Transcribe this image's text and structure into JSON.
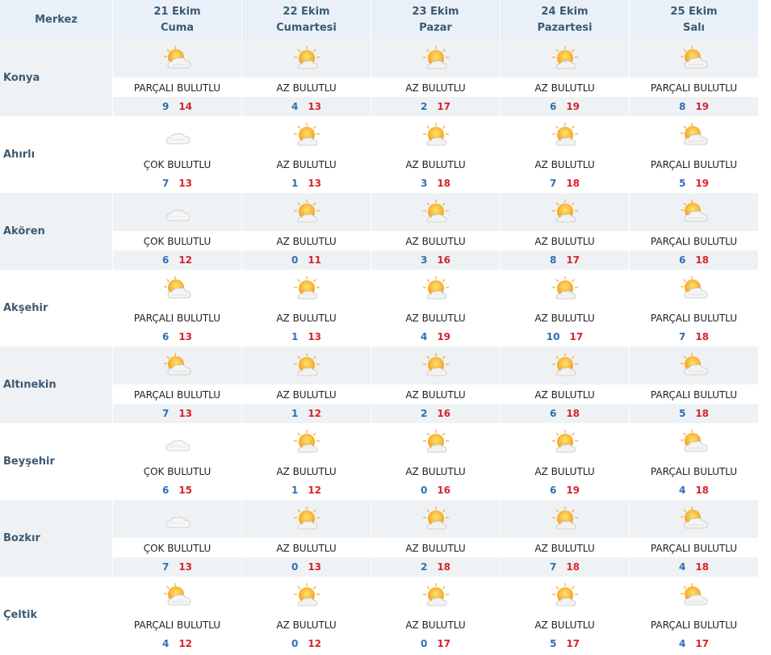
{
  "header": {
    "corner": "Merkez",
    "days": [
      {
        "date": "21 Ekim",
        "weekday": "Cuma"
      },
      {
        "date": "22 Ekim",
        "weekday": "Cumartesi"
      },
      {
        "date": "23 Ekim",
        "weekday": "Pazar"
      },
      {
        "date": "24 Ekim",
        "weekday": "Pazartesi"
      },
      {
        "date": "25 Ekim",
        "weekday": "Salı"
      }
    ]
  },
  "colors": {
    "header_bg": "#e9f0f7",
    "band_bg": "#eef2f5",
    "city_text": "#3d5a73",
    "min_temp": "#2f6fb3",
    "max_temp": "#d9232d"
  },
  "rows": [
    {
      "city": "Konya",
      "shaded": true,
      "days": [
        {
          "icon": "partly-cloudy-icon",
          "condition": "PARÇALI BULUTLU",
          "min": "9",
          "max": "14"
        },
        {
          "icon": "mostly-sunny-icon",
          "condition": "AZ BULUTLU",
          "min": "4",
          "max": "13"
        },
        {
          "icon": "mostly-sunny-icon",
          "condition": "AZ BULUTLU",
          "min": "2",
          "max": "17"
        },
        {
          "icon": "mostly-sunny-icon",
          "condition": "AZ BULUTLU",
          "min": "6",
          "max": "19"
        },
        {
          "icon": "partly-cloudy-icon",
          "condition": "PARÇALI BULUTLU",
          "min": "8",
          "max": "19"
        }
      ]
    },
    {
      "city": "Ahırlı",
      "shaded": false,
      "days": [
        {
          "icon": "cloudy-icon",
          "condition": "ÇOK BULUTLU",
          "min": "7",
          "max": "13"
        },
        {
          "icon": "mostly-sunny-icon",
          "condition": "AZ BULUTLU",
          "min": "1",
          "max": "13"
        },
        {
          "icon": "mostly-sunny-icon",
          "condition": "AZ BULUTLU",
          "min": "3",
          "max": "18"
        },
        {
          "icon": "mostly-sunny-icon",
          "condition": "AZ BULUTLU",
          "min": "7",
          "max": "18"
        },
        {
          "icon": "partly-cloudy-icon",
          "condition": "PARÇALI BULUTLU",
          "min": "5",
          "max": "19"
        }
      ]
    },
    {
      "city": "Akören",
      "shaded": true,
      "days": [
        {
          "icon": "cloudy-icon",
          "condition": "ÇOK BULUTLU",
          "min": "6",
          "max": "12"
        },
        {
          "icon": "mostly-sunny-icon",
          "condition": "AZ BULUTLU",
          "min": "0",
          "max": "11"
        },
        {
          "icon": "mostly-sunny-icon",
          "condition": "AZ BULUTLU",
          "min": "3",
          "max": "16"
        },
        {
          "icon": "mostly-sunny-icon",
          "condition": "AZ BULUTLU",
          "min": "8",
          "max": "17"
        },
        {
          "icon": "partly-cloudy-icon",
          "condition": "PARÇALI BULUTLU",
          "min": "6",
          "max": "18"
        }
      ]
    },
    {
      "city": "Akşehir",
      "shaded": false,
      "days": [
        {
          "icon": "partly-cloudy-icon",
          "condition": "PARÇALI BULUTLU",
          "min": "6",
          "max": "13"
        },
        {
          "icon": "mostly-sunny-icon",
          "condition": "AZ BULUTLU",
          "min": "1",
          "max": "13"
        },
        {
          "icon": "mostly-sunny-icon",
          "condition": "AZ BULUTLU",
          "min": "4",
          "max": "19"
        },
        {
          "icon": "mostly-sunny-icon",
          "condition": "AZ BULUTLU",
          "min": "10",
          "max": "17"
        },
        {
          "icon": "partly-cloudy-icon",
          "condition": "PARÇALI BULUTLU",
          "min": "7",
          "max": "18"
        }
      ]
    },
    {
      "city": "Altınekin",
      "shaded": true,
      "days": [
        {
          "icon": "partly-cloudy-icon",
          "condition": "PARÇALI BULUTLU",
          "min": "7",
          "max": "13"
        },
        {
          "icon": "mostly-sunny-icon",
          "condition": "AZ BULUTLU",
          "min": "1",
          "max": "12"
        },
        {
          "icon": "mostly-sunny-icon",
          "condition": "AZ BULUTLU",
          "min": "2",
          "max": "16"
        },
        {
          "icon": "mostly-sunny-icon",
          "condition": "AZ BULUTLU",
          "min": "6",
          "max": "18"
        },
        {
          "icon": "partly-cloudy-icon",
          "condition": "PARÇALI BULUTLU",
          "min": "5",
          "max": "18"
        }
      ]
    },
    {
      "city": "Beyşehir",
      "shaded": false,
      "days": [
        {
          "icon": "cloudy-icon",
          "condition": "ÇOK BULUTLU",
          "min": "6",
          "max": "15"
        },
        {
          "icon": "mostly-sunny-icon",
          "condition": "AZ BULUTLU",
          "min": "1",
          "max": "12"
        },
        {
          "icon": "mostly-sunny-icon",
          "condition": "AZ BULUTLU",
          "min": "0",
          "max": "16"
        },
        {
          "icon": "mostly-sunny-icon",
          "condition": "AZ BULUTLU",
          "min": "6",
          "max": "19"
        },
        {
          "icon": "partly-cloudy-icon",
          "condition": "PARÇALI BULUTLU",
          "min": "4",
          "max": "18"
        }
      ]
    },
    {
      "city": "Bozkır",
      "shaded": true,
      "days": [
        {
          "icon": "cloudy-icon",
          "condition": "ÇOK BULUTLU",
          "min": "7",
          "max": "13"
        },
        {
          "icon": "mostly-sunny-icon",
          "condition": "AZ BULUTLU",
          "min": "0",
          "max": "13"
        },
        {
          "icon": "mostly-sunny-icon",
          "condition": "AZ BULUTLU",
          "min": "2",
          "max": "18"
        },
        {
          "icon": "mostly-sunny-icon",
          "condition": "AZ BULUTLU",
          "min": "7",
          "max": "18"
        },
        {
          "icon": "partly-cloudy-icon",
          "condition": "PARÇALI BULUTLU",
          "min": "4",
          "max": "18"
        }
      ]
    },
    {
      "city": "Çeltik",
      "shaded": false,
      "days": [
        {
          "icon": "partly-cloudy-icon",
          "condition": "PARÇALI BULUTLU",
          "min": "4",
          "max": "12"
        },
        {
          "icon": "mostly-sunny-icon",
          "condition": "AZ BULUTLU",
          "min": "0",
          "max": "12"
        },
        {
          "icon": "mostly-sunny-icon",
          "condition": "AZ BULUTLU",
          "min": "0",
          "max": "17"
        },
        {
          "icon": "mostly-sunny-icon",
          "condition": "AZ BULUTLU",
          "min": "5",
          "max": "17"
        },
        {
          "icon": "partly-cloudy-icon",
          "condition": "PARÇALI BULUTLU",
          "min": "4",
          "max": "17"
        }
      ]
    }
  ]
}
